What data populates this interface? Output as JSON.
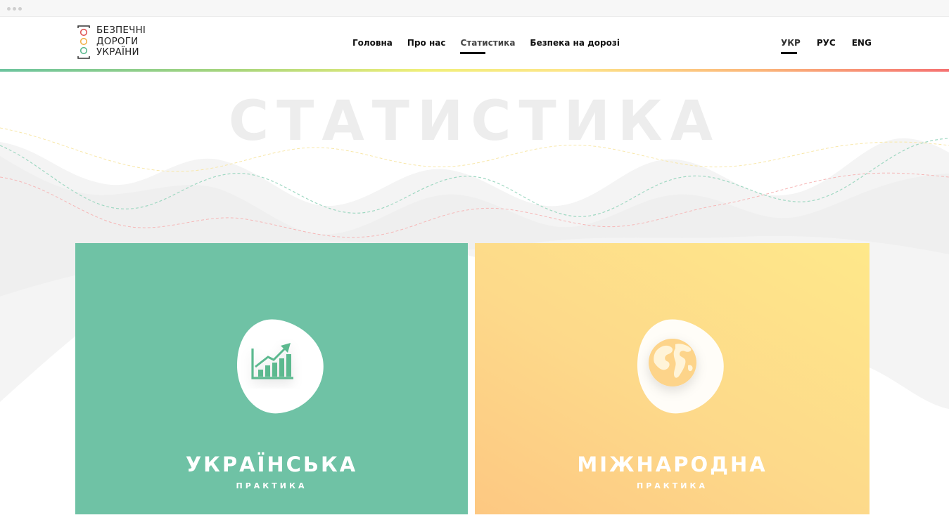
{
  "logo": {
    "lines": [
      "БЕЗПЕЧНІ",
      "ДОРОГИ",
      "УКРАЇНИ"
    ],
    "light_colors": [
      "#e05656",
      "#f2b14b",
      "#5cb98f"
    ]
  },
  "nav": {
    "items": [
      {
        "label": "Головна"
      },
      {
        "label": "Про нас"
      },
      {
        "label": "Статистика"
      },
      {
        "label": "Безпека на дорозі"
      }
    ],
    "active_index": 2
  },
  "languages": {
    "items": [
      {
        "label": "УКР"
      },
      {
        "label": "РУС"
      },
      {
        "label": "ENG"
      }
    ],
    "active_index": 0
  },
  "hero": {
    "title": "СТАТИСТИКА"
  },
  "cards": [
    {
      "title": "УКРАЇНСЬКА",
      "subtitle": "ПРАКТИКА",
      "icon": "growth-chart-icon",
      "color": "#6fc2a5"
    },
    {
      "title": "МІЖНАРОДНА",
      "subtitle": "ПРАКТИКА",
      "icon": "globe-icon",
      "color": "#fdd48a"
    }
  ],
  "colors": {
    "green": "#6fc2a5",
    "yellow": "#fee88a",
    "orange": "#fdc882",
    "red": "#f57272"
  }
}
